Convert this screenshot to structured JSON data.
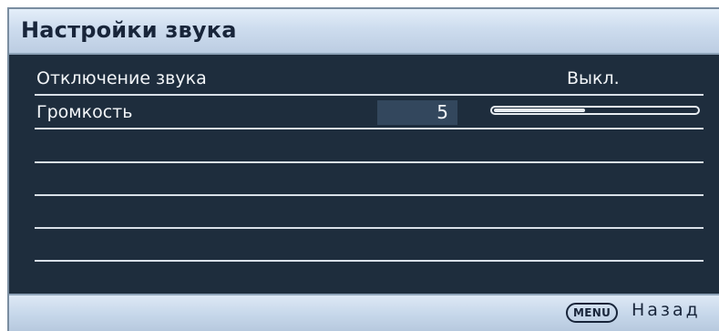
{
  "header": {
    "title": "Настройки звука"
  },
  "rows": [
    {
      "label": "Отключение звука",
      "value": "Выкл."
    },
    {
      "label": "Громкость",
      "value": "5",
      "level_fraction": 0.45
    },
    {
      "label": ""
    },
    {
      "label": ""
    },
    {
      "label": ""
    },
    {
      "label": ""
    }
  ],
  "footer": {
    "menu_key": "MENU",
    "back_label": "Назад"
  },
  "colors": {
    "panel_bg": "#1e2d3d",
    "header_bg": "#cddcee",
    "text_light": "#f2f5f8",
    "text_dark": "#18253a",
    "highlight_box": "#33475d"
  }
}
